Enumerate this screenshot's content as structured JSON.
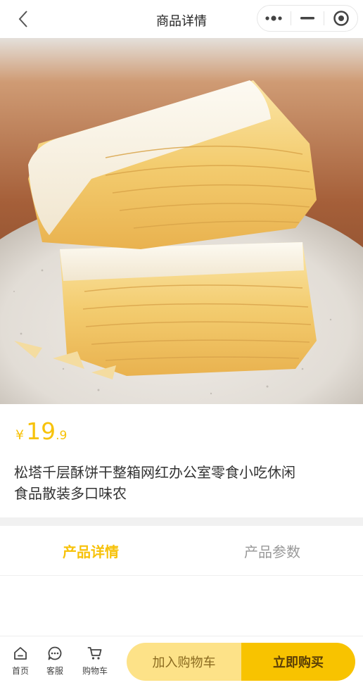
{
  "header": {
    "title": "商品详情",
    "back_icon": "chevron-left-icon",
    "capsule": {
      "more_icon": "more-dots-icon",
      "minimize_icon": "minus-icon",
      "close_icon": "target-circle-icon"
    }
  },
  "product": {
    "image_subject": "layered puff pastry biscuits on a ceramic plate",
    "price": {
      "symbol": "¥",
      "integer": "19",
      "decimal": ".9"
    },
    "title_line1": "松塔千层酥饼干整箱网红办公室零食小吃休闲",
    "title_line2": "食品散装多口味农"
  },
  "tabs": [
    {
      "label": "产品详情",
      "active": true
    },
    {
      "label": "产品参数",
      "active": false
    }
  ],
  "bottom_bar": {
    "nav": [
      {
        "label": "首页",
        "icon": "home-icon"
      },
      {
        "label": "客服",
        "icon": "chat-bubble-icon"
      },
      {
        "label": "购物车",
        "icon": "cart-icon"
      }
    ],
    "add_to_cart": "加入购物车",
    "buy_now": "立即购买"
  },
  "colors": {
    "accent": "#f7c20a",
    "add_to_cart_bg": "#fde288",
    "buy_now_bg": "#f8c300",
    "divider": "#f1f1f1"
  }
}
